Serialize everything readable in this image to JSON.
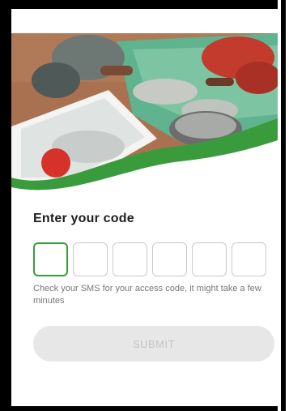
{
  "login": {
    "heading": "Enter your code",
    "code_length": 6,
    "active_box_index": 0,
    "hint": "Check your SMS for your access code, it might take a few minutes",
    "submit_label": "SUBMIT",
    "submit_enabled": false
  },
  "colors": {
    "accent_green": "#3a9b3c",
    "box_border": "#c9c9c9",
    "disabled_button_bg": "#e7e7e7",
    "disabled_button_text": "#c4c4c4"
  },
  "hero": {
    "icon": "fish-sorting-photo"
  }
}
